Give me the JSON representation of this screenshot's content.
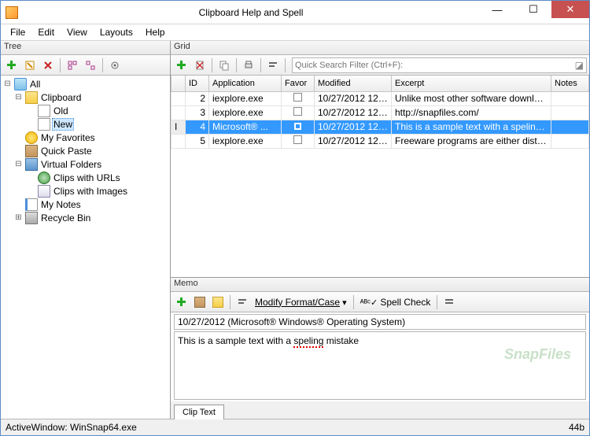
{
  "window": {
    "title": "Clipboard Help and Spell"
  },
  "menu": {
    "file": "File",
    "edit": "Edit",
    "view": "View",
    "layouts": "Layouts",
    "help": "Help"
  },
  "panes": {
    "tree": "Tree",
    "grid": "Grid",
    "memo": "Memo"
  },
  "search": {
    "placeholder": "Quick Search Filter (Ctrl+F):"
  },
  "tree": {
    "all": "All",
    "clipboard": "Clipboard",
    "old": "Old",
    "new": "New",
    "favorites": "My Favorites",
    "quickpaste": "Quick Paste",
    "virtualfolders": "Virtual Folders",
    "clipsurls": "Clips with URLs",
    "clipsimages": "Clips with Images",
    "mynotes": "My Notes",
    "recyclebin": "Recycle Bin"
  },
  "grid": {
    "headers": {
      "id": "ID",
      "application": "Application",
      "favor": "Favor",
      "modified": "Modified",
      "excerpt": "Excerpt",
      "notes": "Notes"
    },
    "rows": [
      {
        "id": "2",
        "app": "iexplore.exe",
        "favor": false,
        "modified": "10/27/2012 12:...",
        "excerpt": "Unlike most other software download site...",
        "notes": ""
      },
      {
        "id": "3",
        "app": "iexplore.exe",
        "favor": false,
        "modified": "10/27/2012 12:...",
        "excerpt": "http://snapfiles.com/",
        "notes": ""
      },
      {
        "id": "4",
        "app": "Microsoft® ...",
        "favor": true,
        "modified": "10/27/2012 12:...",
        "excerpt": "This is a sample text with a speling mistake",
        "notes": ""
      },
      {
        "id": "5",
        "app": "iexplore.exe",
        "favor": false,
        "modified": "10/27/2012 12:...",
        "excerpt": "Freeware programs are either distributed f...",
        "notes": ""
      }
    ]
  },
  "memo": {
    "toolbar": {
      "modify": "Modify Format/Case",
      "spell": "Spell Check"
    },
    "info": "10/27/2012 (Microsoft® Windows® Operating System)",
    "text_pre": "This is a sample text with a ",
    "text_err": "speling",
    "text_post": " mistake",
    "tab": "Clip Text"
  },
  "status": {
    "left": "ActiveWindow: WinSnap64.exe",
    "right": "44b"
  },
  "watermark": "SnapFiles"
}
